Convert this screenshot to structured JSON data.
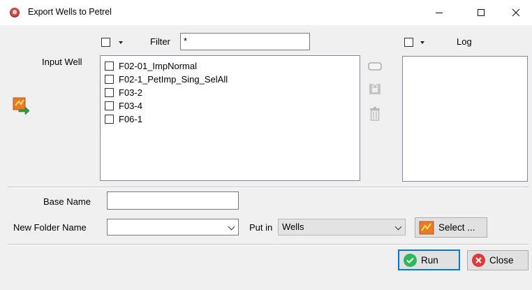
{
  "window": {
    "title": "Export Wells to Petrel"
  },
  "filter": {
    "label": "Filter",
    "value": "*"
  },
  "log": {
    "label": "Log"
  },
  "input_well": {
    "label": "Input Well",
    "items": [
      "F02-01_ImpNormal",
      "F02-1_PetImp_Sing_SelAll",
      "F03-2",
      "F03-4",
      "F06-1"
    ]
  },
  "base_name": {
    "label": "Base Name",
    "value": ""
  },
  "new_folder": {
    "label": "New Folder Name",
    "value": ""
  },
  "put_in": {
    "label": "Put in",
    "value": "Wells"
  },
  "buttons": {
    "select": "Select ...",
    "run": "Run",
    "close": "Close"
  },
  "icons": {
    "app": "app-logo-icon",
    "transfer": "export-arrow-icon",
    "lock": "lock-icon",
    "delete": "trash-icon",
    "clear": "clear-icon"
  },
  "colors": {
    "accent": "#0078d7",
    "run": "#2eb85c",
    "close": "#e03b3b"
  }
}
